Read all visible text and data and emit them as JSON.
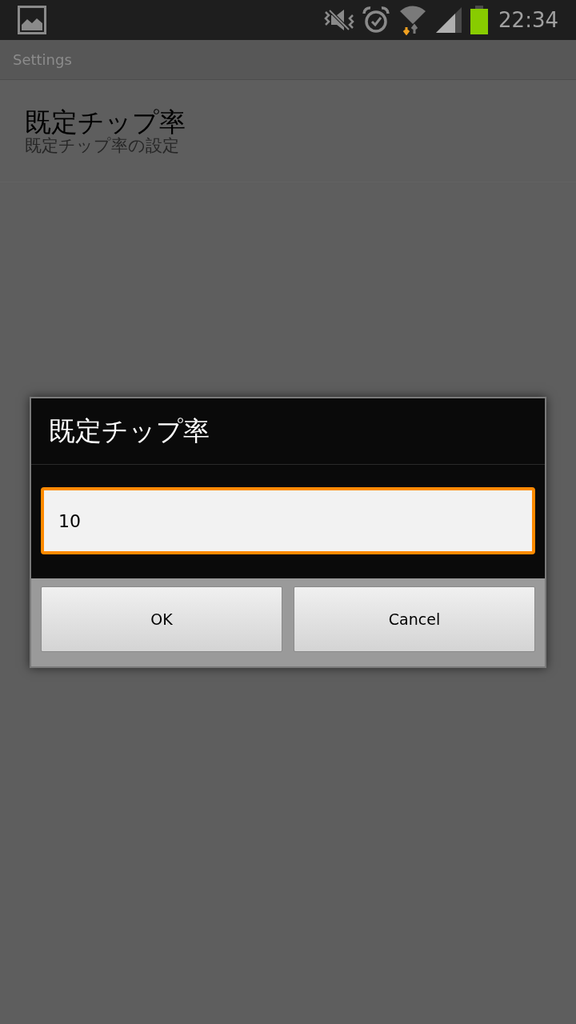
{
  "status_bar": {
    "time": "22:34"
  },
  "app_bar": {
    "title": "Settings"
  },
  "preferences": [
    {
      "title": "既定チップ率",
      "summary": "既定チップ率の設定"
    }
  ],
  "dialog": {
    "title": "既定チップ率",
    "input": {
      "value": "10",
      "focused": true
    },
    "buttons": [
      "OK",
      "Cancel"
    ]
  }
}
